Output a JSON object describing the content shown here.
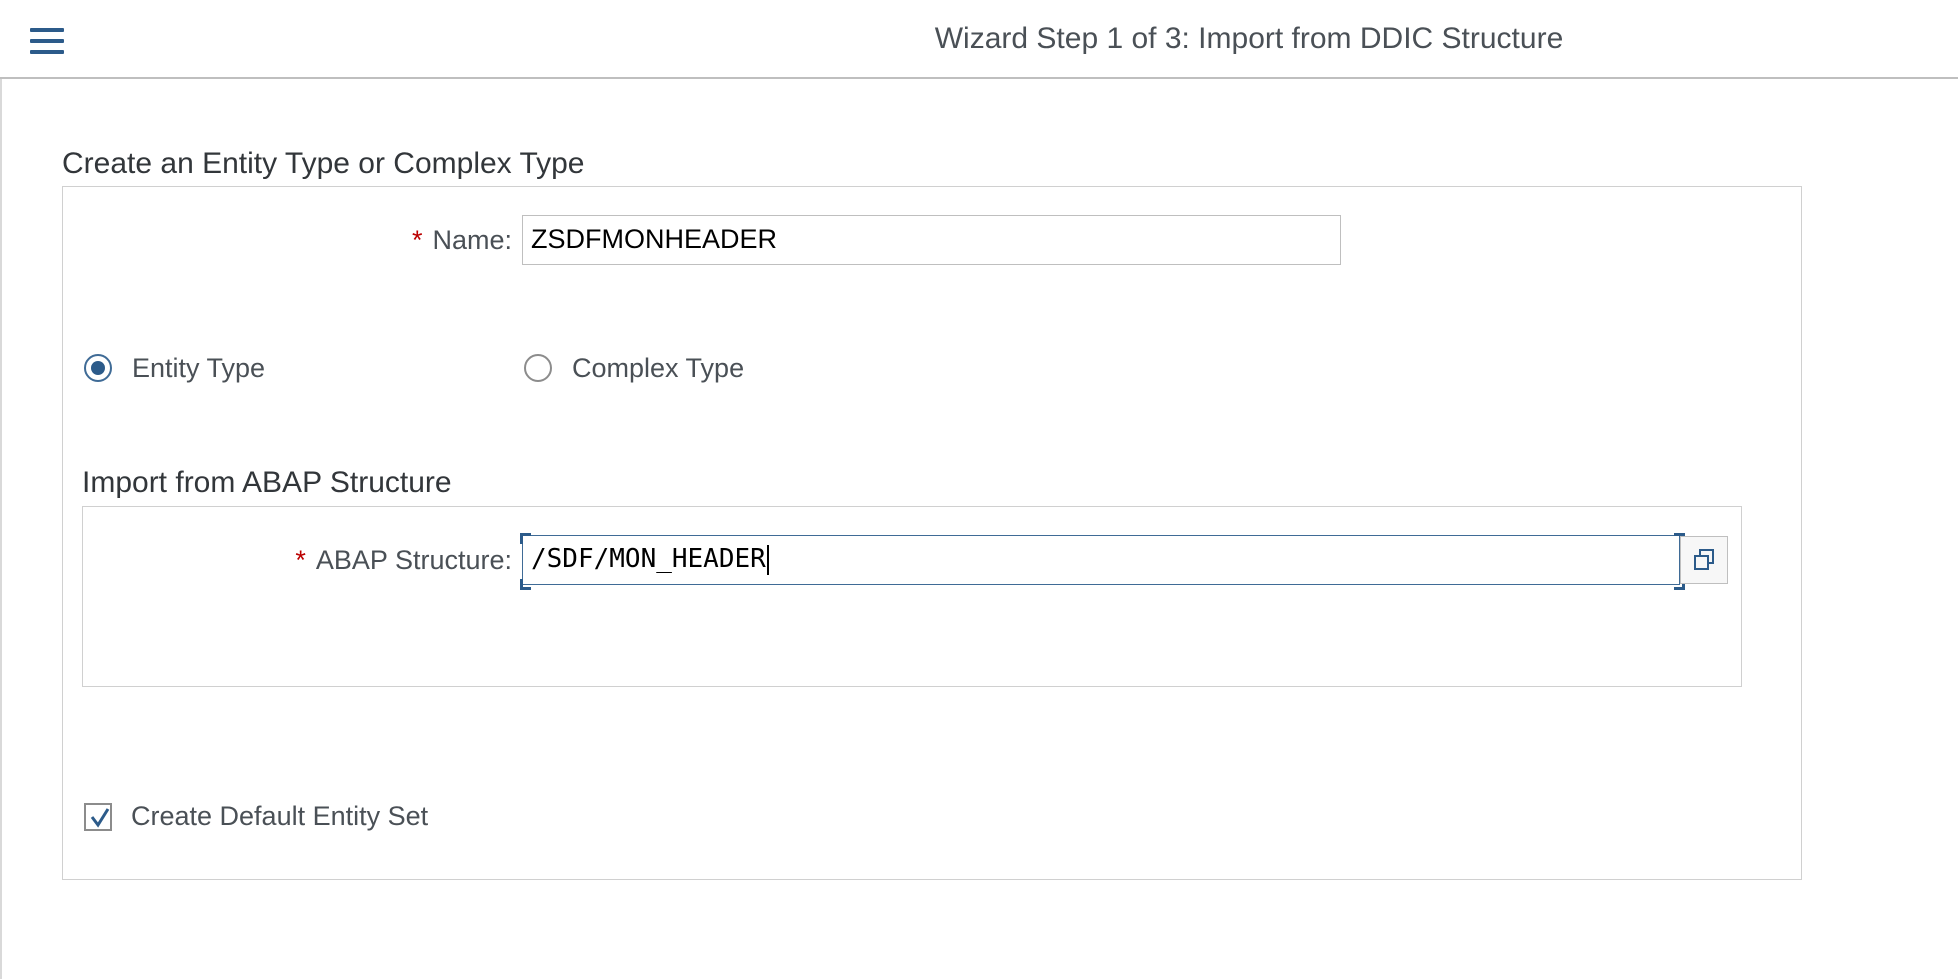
{
  "header": {
    "title": "Wizard Step 1 of 3: Import from DDIC Structure",
    "menu_icon": "hamburger-menu-icon"
  },
  "form": {
    "section_title": "Create an Entity Type or Complex Type",
    "required_marker": "*",
    "name_label": "Name:",
    "name_value": "ZSDFMONHEADER",
    "type_options": [
      {
        "label": "Entity Type",
        "selected": true
      },
      {
        "label": "Complex Type",
        "selected": false
      }
    ],
    "import": {
      "section_title": "Import from ABAP Structure",
      "structure_label": "ABAP Structure:",
      "structure_value": "/SDF/MON_HEADER",
      "value_help_icon": "value-help-icon"
    },
    "default_entity_set": {
      "label": "Create Default Entity Set",
      "checked": true
    }
  },
  "colors": {
    "accent": "#2c5b8a",
    "required": "#bb0000"
  }
}
